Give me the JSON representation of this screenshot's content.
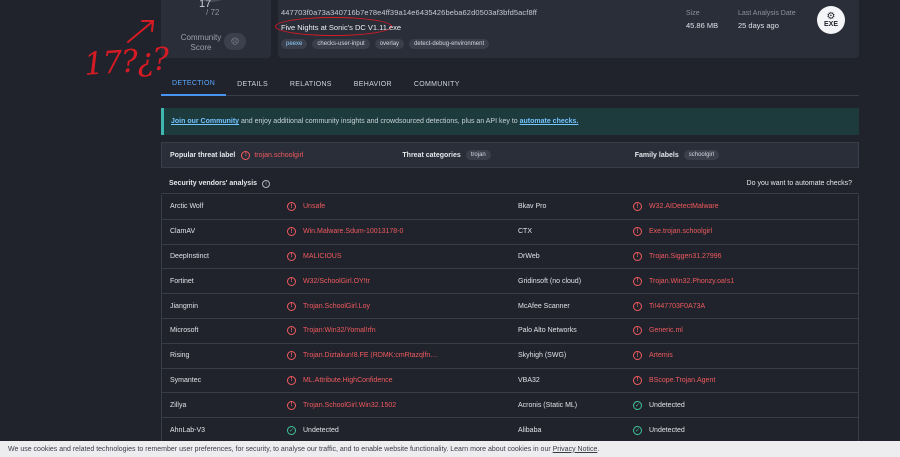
{
  "score": {
    "detections": "17",
    "total": "/ 72",
    "community_label": "Community Score",
    "community_icon": "neutral-face-icon"
  },
  "file": {
    "hash": "447703f0a73a340716b7e78e4ff39a14e6435426beba62d0503af3bfd5acf8ff",
    "name": "Five Nights at Sonic's DC V1.11.exe",
    "tags": [
      "peexe",
      "checks-user-input",
      "overlay",
      "detect-debug-environment"
    ],
    "size_label": "Size",
    "size_value": "45.86 MB",
    "last_analysis_label": "Last Analysis Date",
    "last_analysis_value": "25 days ago",
    "type_icon": "EXE"
  },
  "annotation": {
    "text": "17?¿?",
    "color": "#d61b24"
  },
  "tabs": [
    "DETECTION",
    "DETAILS",
    "RELATIONS",
    "BEHAVIOR",
    "COMMUNITY"
  ],
  "banner": {
    "link1": "Join our Community",
    "text1": " and enjoy additional community insights and crowdsourced detections, plus an API key to ",
    "link2": "automate checks."
  },
  "threat": {
    "popular_label": "Popular threat label",
    "popular_value": "trojan.schoolgirl",
    "categories_label": "Threat categories",
    "categories_value": "trojan",
    "family_label": "Family labels",
    "family_value": "schoolgirl"
  },
  "vendors_header": {
    "title": "Security vendors' analysis",
    "automate": "Do you want to automate checks?"
  },
  "vendors": [
    {
      "left": "Arctic Wolf",
      "left_result": "Unsafe",
      "left_status": "bad",
      "right": "Bkav Pro",
      "right_result": "W32.AIDetectMalware",
      "right_status": "bad"
    },
    {
      "left": "ClamAV",
      "left_result": "Win.Malware.Sdum-10013178-0",
      "left_status": "bad",
      "right": "CTX",
      "right_result": "Exe.trojan.schoolgirl",
      "right_status": "bad"
    },
    {
      "left": "DeepInstinct",
      "left_result": "MALICIOUS",
      "left_status": "bad",
      "right": "DrWeb",
      "right_result": "Trojan.Siggen31.27996",
      "right_status": "bad"
    },
    {
      "left": "Fortinet",
      "left_result": "W32/SchoolGirl.OY!tr",
      "left_status": "bad",
      "right": "Gridinsoft (no cloud)",
      "right_result": "Trojan.Win32.Phonzy.oa!s1",
      "right_status": "bad"
    },
    {
      "left": "Jiangmin",
      "left_result": "Trojan.SchoolGirl.Loy",
      "left_status": "bad",
      "right": "McAfee Scanner",
      "right_result": "Ti!447703F0A73A",
      "right_status": "bad"
    },
    {
      "left": "Microsoft",
      "left_result": "Trojan:Win32/Yomal!rfn",
      "left_status": "bad",
      "right": "Palo Alto Networks",
      "right_result": "Generic.ml",
      "right_status": "bad"
    },
    {
      "left": "Rising",
      "left_result": "Trojan.Diztakun!8.FE (RDMK:cmRtazqlfn…",
      "left_status": "bad",
      "right": "Skyhigh (SWG)",
      "right_result": "Artemis",
      "right_status": "bad"
    },
    {
      "left": "Symantec",
      "left_result": "ML.Attribute.HighConfidence",
      "left_status": "bad",
      "right": "VBA32",
      "right_result": "BScope.Trojan.Agent",
      "right_status": "bad"
    },
    {
      "left": "Zillya",
      "left_result": "Trojan.SchoolGirl.Win32.1502",
      "left_status": "bad",
      "right": "Acronis (Static ML)",
      "right_result": "Undetected",
      "right_status": "ok"
    },
    {
      "left": "AhnLab-V3",
      "left_result": "Undetected",
      "left_status": "ok",
      "right": "Alibaba",
      "right_result": "Undetected",
      "right_status": "ok"
    }
  ],
  "cookie": {
    "text": "We use cookies and related technologies to remember user preferences, for security, to analyse our traffic, and to enable website functionality. Learn more about cookies in our ",
    "link": "Privacy Notice",
    "end": "."
  },
  "colors": {
    "malicious": "#ef5a5f",
    "clean": "#42c49b",
    "accent": "#4a94f2",
    "background": "#20232b"
  }
}
